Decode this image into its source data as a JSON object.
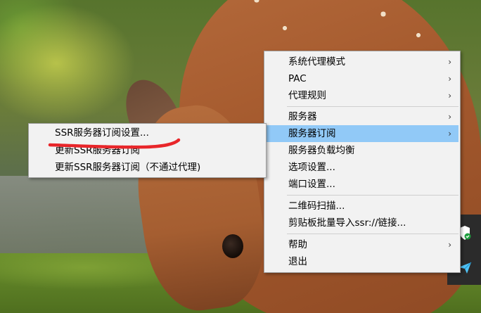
{
  "main_menu": {
    "items": [
      {
        "label": "系统代理模式",
        "submenu": true
      },
      {
        "label": "PAC",
        "submenu": true
      },
      {
        "label": "代理规则",
        "submenu": true
      },
      {
        "label": "服务器",
        "submenu": true
      },
      {
        "label": "服务器订阅",
        "submenu": true,
        "highlighted": true
      },
      {
        "label": "服务器负载均衡",
        "submenu": false
      },
      {
        "label": "选项设置...",
        "submenu": false
      },
      {
        "label": "端口设置...",
        "submenu": false
      },
      {
        "label": "二维码扫描...",
        "submenu": false
      },
      {
        "label": "剪贴板批量导入ssr://链接...",
        "submenu": false
      },
      {
        "label": "帮助",
        "submenu": true
      },
      {
        "label": "退出",
        "submenu": false
      }
    ]
  },
  "sub_menu": {
    "items": [
      {
        "label": "SSR服务器订阅设置..."
      },
      {
        "label": "更新SSR服务器订阅"
      },
      {
        "label": "更新SSR服务器订阅（不通过代理)"
      }
    ]
  },
  "icons": {
    "submenu_arrow": "chevron-right-icon",
    "tray": [
      "shield-check-icon",
      "paper-plane-icon"
    ]
  },
  "colors": {
    "menu_bg": "#f2f2f2",
    "highlight": "#91c9f7",
    "annotation": "#e8262a"
  }
}
